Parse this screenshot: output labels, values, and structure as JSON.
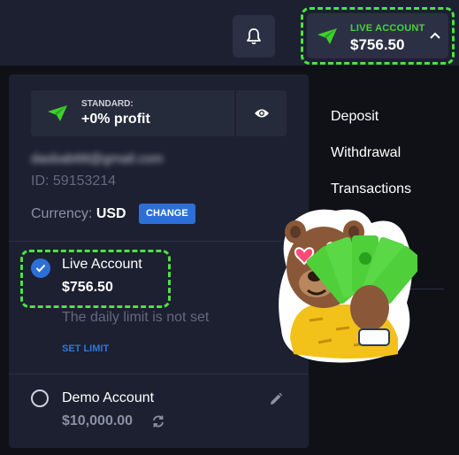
{
  "topbar": {
    "account_chip": {
      "label": "LIVE ACCOUNT",
      "balance": "$756.50"
    }
  },
  "panel": {
    "plan": {
      "label": "STANDARD:",
      "profit": "+0% profit"
    },
    "email": "dasbab68@gmail.com",
    "account_id": "ID: 59153214",
    "currency_label": "Currency:",
    "currency_value": "USD",
    "change_label": "CHANGE",
    "live_account": {
      "title": "Live Account",
      "balance": "$756.50",
      "daily_limit": "The daily limit is not set",
      "set_limit_label": "SET LIMIT"
    },
    "demo_account": {
      "title": "Demo Account",
      "balance": "$10,000.00"
    }
  },
  "menu": {
    "items": [
      "Deposit",
      "Withdrawal",
      "Transactions"
    ]
  },
  "colors": {
    "accent_green": "#4fe045",
    "accent_blue": "#2d6fd8",
    "panel_bg": "#1c2030"
  },
  "icons": [
    "bell-icon",
    "paper-plane-icon",
    "chevron-up-icon",
    "eye-icon",
    "check-icon",
    "pencil-icon",
    "refresh-icon"
  ]
}
